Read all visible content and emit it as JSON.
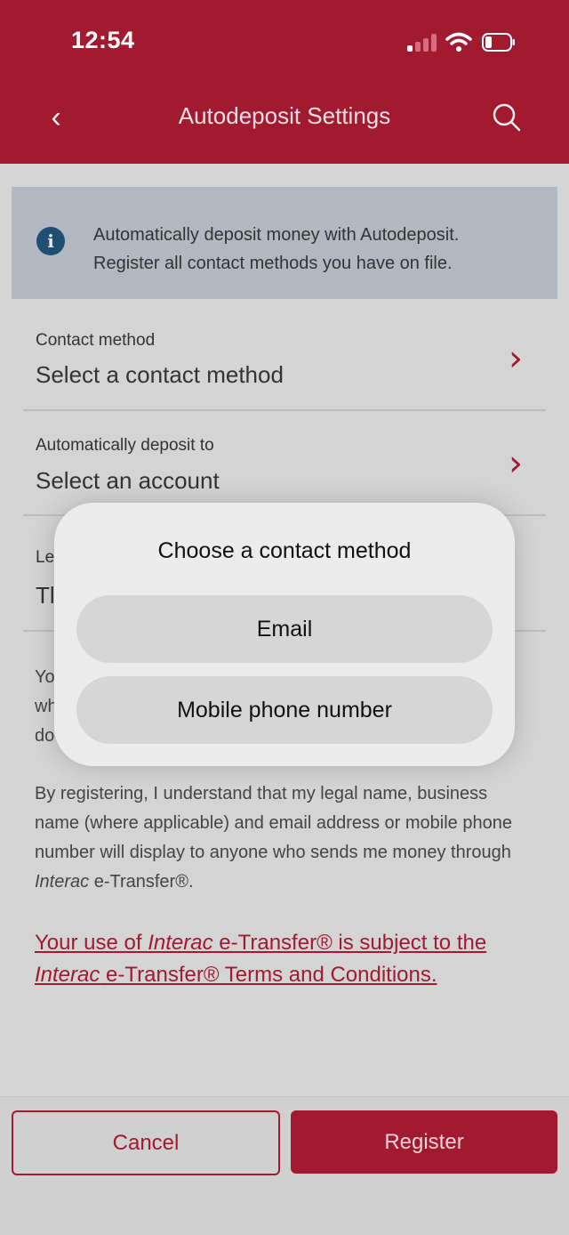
{
  "status_bar": {
    "time": "12:54"
  },
  "header": {
    "title": "Autodeposit Settings"
  },
  "info_banner": {
    "lines": [
      "Automatically deposit money with Autodeposit.",
      "Register all contact methods you have on file."
    ]
  },
  "fields": [
    {
      "label": "Contact method",
      "value": "Select a contact method"
    },
    {
      "label": "Automatically deposit to",
      "value": "Select an account"
    }
  ],
  "obscured": {
    "field_label_fragment": "Le",
    "field_value_fragment": "Tl",
    "paragraph_fragments": [
      "Yo",
      "wh",
      "do"
    ]
  },
  "legal_text": {
    "before_italic": "By registering, I understand that my legal name, business name (where applicable) and email address or mobile phone number will display to anyone who sends me money through ",
    "italic": "Interac",
    "after_italic": " e-Transfer®."
  },
  "terms_link": {
    "part1": "Your use of ",
    "italic1": "Interac",
    "part2": " e-Transfer® is subject to the ",
    "italic2": "Interac",
    "part3": " e-Transfer® Terms and Conditions."
  },
  "footer": {
    "cancel_label": "Cancel",
    "register_label": "Register"
  },
  "dialog": {
    "title": "Choose a contact method",
    "options": [
      "Email",
      "Mobile phone number"
    ]
  },
  "colors": {
    "brand": "#a11a2f",
    "info_bg": "#b2b8c2",
    "info_icon": "#1f4f72"
  }
}
